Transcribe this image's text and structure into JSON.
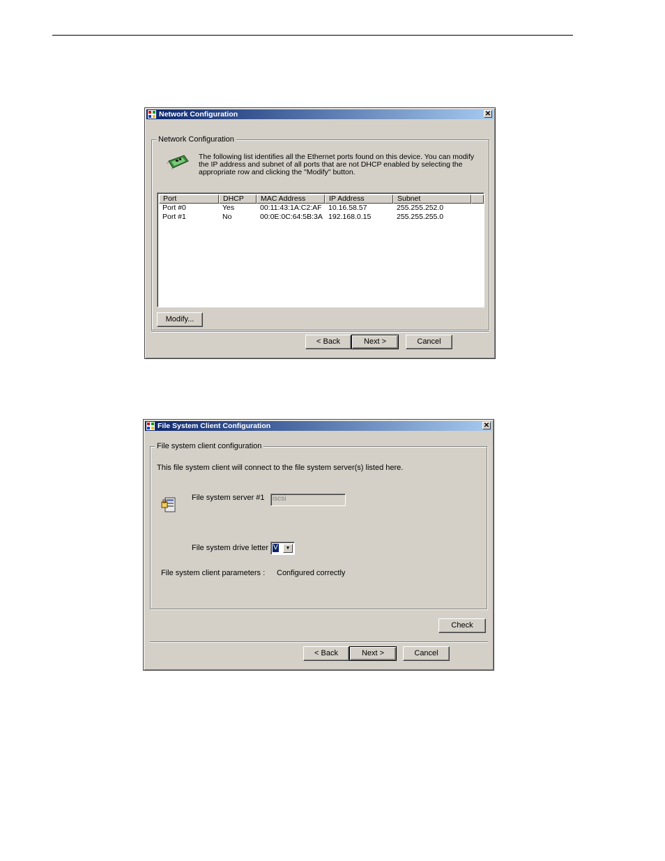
{
  "network_dialog": {
    "title": "Network Configuration",
    "close_glyph": "✕",
    "group_title": "Network Configuration",
    "description": "The following list identifies all the Ethernet ports found on this device. You can modify the IP address and subnet of all ports that are not DHCP enabled by selecting the appropriate row and clicking the \"Modify\" button.",
    "columns": [
      "Port",
      "DHCP",
      "MAC Address",
      "IP Address",
      "Subnet"
    ],
    "rows": [
      [
        "Port #0",
        "Yes",
        "00:11:43:1A:C2:AF",
        "10.16.58.57",
        "255.255.252.0"
      ],
      [
        "Port #1",
        "No",
        "00:0E:0C:64:5B:3A",
        "192.168.0.15",
        "255.255.255.0"
      ]
    ],
    "modify_label": "Modify...",
    "back_label": "< Back",
    "next_label": "Next >",
    "cancel_label": "Cancel"
  },
  "fs_dialog": {
    "title": "File System Client Configuration",
    "close_glyph": "✕",
    "group_title": "File system client configuration",
    "intro": "This file system client will connect to the file system server(s) listed here.",
    "server_label": "File system server #1",
    "server_value": "iscsi",
    "drive_label": "File system drive letter",
    "drive_value": "V",
    "params_label": "File system client parameters :",
    "params_value": "Configured correctly",
    "check_label": "Check",
    "back_label": "< Back",
    "next_label": "Next >",
    "cancel_label": "Cancel"
  },
  "icons": {
    "app": "windows-app-icon",
    "network": "network-card-icon",
    "server": "file-server-icon",
    "dropdown": "chevron-down-icon"
  },
  "colors": {
    "titlebar_start": "#0a246a",
    "titlebar_end": "#a6caf0",
    "dialog_face": "#d4d0c8"
  }
}
